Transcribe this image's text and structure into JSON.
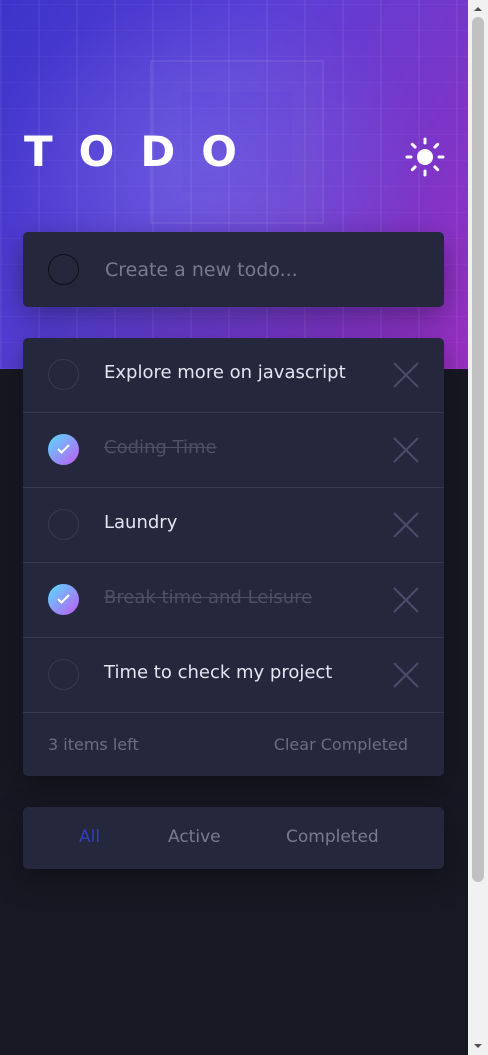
{
  "header": {
    "title": "TODO",
    "theme_icon": "sun-icon"
  },
  "new_todo": {
    "placeholder": "Create a new todo..."
  },
  "todos": [
    {
      "text": "Explore more on javascript",
      "completed": false
    },
    {
      "text": "Coding Time",
      "completed": true
    },
    {
      "text": "Laundry",
      "completed": false
    },
    {
      "text": "Break time and Leisure",
      "completed": true
    },
    {
      "text": "Time to check my project",
      "completed": false
    }
  ],
  "footer": {
    "items_left": "3 items left",
    "clear_label": "Clear Completed"
  },
  "filters": {
    "all": "All",
    "active": "Active",
    "completed": "Completed",
    "selected": "All"
  },
  "colors": {
    "background": "#181824",
    "card": "#25273c",
    "accent": "#2f3fbf",
    "check_gradient_start": "#57ddff",
    "check_gradient_end": "#c058f3"
  }
}
